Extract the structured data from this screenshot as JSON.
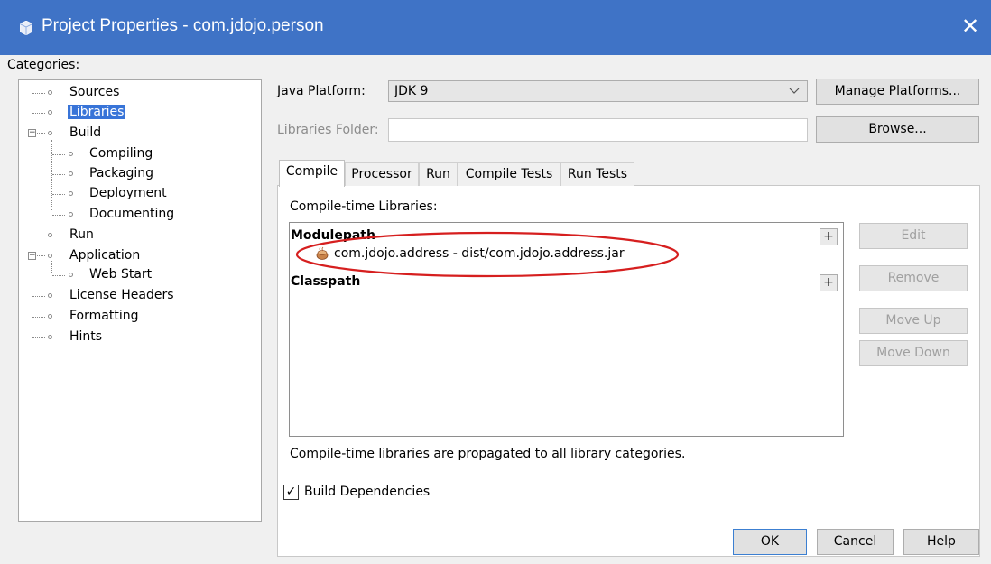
{
  "window": {
    "title": "Project Properties - com.jdojo.person",
    "close_label": "✕"
  },
  "categories": {
    "label": "Categories:",
    "items": [
      {
        "label": "Sources"
      },
      {
        "label": "Libraries",
        "selected": true
      },
      {
        "label": "Build",
        "expander": "−"
      },
      {
        "label": "Compiling"
      },
      {
        "label": "Packaging"
      },
      {
        "label": "Deployment"
      },
      {
        "label": "Documenting"
      },
      {
        "label": "Run"
      },
      {
        "label": "Application",
        "expander": "−"
      },
      {
        "label": "Web Start"
      },
      {
        "label": "License Headers"
      },
      {
        "label": "Formatting"
      },
      {
        "label": "Hints"
      }
    ]
  },
  "java_platform": {
    "label": "Java Platform:",
    "value": "JDK 9",
    "manage_button": "Manage Platforms..."
  },
  "libraries_folder": {
    "label": "Libraries Folder:",
    "value": "",
    "browse_button": "Browse..."
  },
  "tabs": [
    {
      "label": "Compile",
      "active": true
    },
    {
      "label": "Processor"
    },
    {
      "label": "Run"
    },
    {
      "label": "Compile Tests"
    },
    {
      "label": "Run Tests"
    }
  ],
  "compile": {
    "libraries_label": "Compile-time Libraries:",
    "modulepath_label": "Modulepath",
    "modulepath_entry": "com.jdojo.address - dist/com.jdojo.address.jar",
    "classpath_label": "Classpath",
    "plus_label": "+",
    "side_buttons": [
      "Edit",
      "Remove",
      "Move Up",
      "Move Down"
    ],
    "note": "Compile-time libraries are propagated to all library categories."
  },
  "build_dependencies": {
    "label": "Build Dependencies",
    "checked": true,
    "check_mark": "✓"
  },
  "footer": {
    "ok": "OK",
    "cancel": "Cancel",
    "help": "Help"
  },
  "colors": {
    "titlebar": "#3f73c6",
    "selection": "#3874d8",
    "annotation_ellipse": "#d61f1f"
  },
  "icons": {
    "title": "netbeans-project-icon",
    "jar": "jar-library-icon"
  }
}
